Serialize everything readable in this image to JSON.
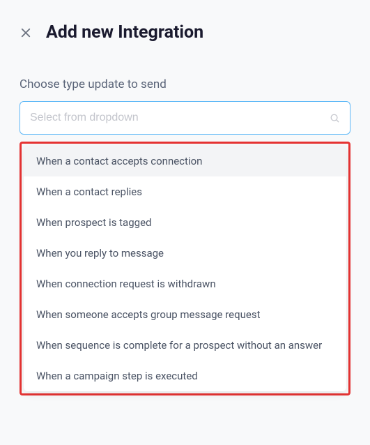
{
  "header": {
    "title": "Add new Integration"
  },
  "form": {
    "label": "Choose type update to send",
    "placeholder": "Select from dropdown"
  },
  "dropdown": {
    "items": [
      {
        "label": "When a contact accepts connection"
      },
      {
        "label": "When a contact replies"
      },
      {
        "label": "When prospect is tagged"
      },
      {
        "label": "When you reply to message"
      },
      {
        "label": "When connection request is withdrawn"
      },
      {
        "label": "When someone accepts group message request"
      },
      {
        "label": "When sequence is complete for a prospect without an answer"
      },
      {
        "label": "When a campaign step is executed"
      }
    ]
  }
}
